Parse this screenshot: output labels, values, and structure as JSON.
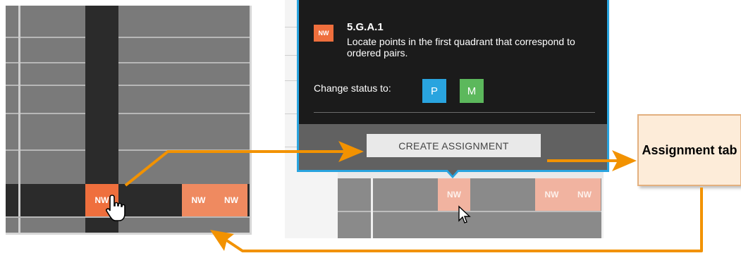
{
  "left_panel": {
    "active_cell": "NW",
    "cells": [
      "NW",
      "NW"
    ]
  },
  "popup": {
    "badge": "NW",
    "standard_code": "5.G.A.1",
    "description": "Locate points in the first quadrant that correspond to ordered pairs.",
    "change_status_label": "Change status to:",
    "status_buttons": [
      "P",
      "M"
    ],
    "create_assignment_label": "CREATE ASSIGNMENT",
    "accent_color": "#29a4df"
  },
  "right_panel": {
    "hovered_cell": "NW",
    "cells": [
      "NW",
      "NW"
    ]
  },
  "callout": {
    "label": "Assignment tab"
  },
  "colors": {
    "arrow": "#f29200",
    "nw_cell": "#ef6f3d",
    "mastered": "#5cb85c"
  }
}
